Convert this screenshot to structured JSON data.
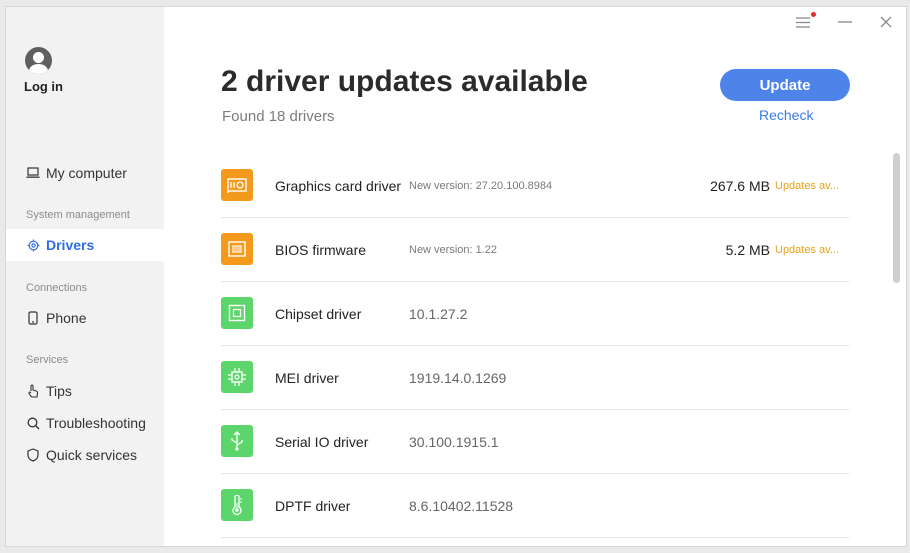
{
  "user": {
    "login_label": "Log in"
  },
  "nav": {
    "my_computer": "My computer",
    "section_system": "System management",
    "drivers": "Drivers",
    "section_connections": "Connections",
    "phone": "Phone",
    "section_services": "Services",
    "tips": "Tips",
    "troubleshooting": "Troubleshooting",
    "quick_services": "Quick services"
  },
  "main": {
    "headline": "2 driver updates available",
    "subhead": "Found 18 drivers",
    "update_label": "Update",
    "recheck_label": "Recheck"
  },
  "drivers": [
    {
      "name": "Graphics card driver",
      "version": "New version: 27.20.100.8984",
      "size": "267.6 MB",
      "status": "Updates av...",
      "icon": "graphics-card-icon",
      "color": "#f39a1c"
    },
    {
      "name": "BIOS firmware",
      "version": "New version: 1.22",
      "size": "5.2 MB",
      "status": "Updates av...",
      "icon": "bios-chip-icon",
      "color": "#f39a1c"
    },
    {
      "name": "Chipset driver",
      "version": "10.1.27.2",
      "icon": "chipset-icon",
      "color": "#5cd56b"
    },
    {
      "name": "MEI driver",
      "version": "1919.14.0.1269",
      "icon": "mei-cpu-icon",
      "color": "#5cd56b"
    },
    {
      "name": "Serial IO driver",
      "version": "30.100.1915.1",
      "icon": "usb-icon",
      "color": "#5cd56b"
    },
    {
      "name": "DPTF driver",
      "version": "8.6.10402.11528",
      "icon": "thermometer-icon",
      "color": "#5cd56b"
    }
  ],
  "colors": {
    "accent": "#4e83ea",
    "update_orange": "#f39a1c",
    "ok_green": "#5cd56b",
    "status_text": "#e8a11c"
  }
}
